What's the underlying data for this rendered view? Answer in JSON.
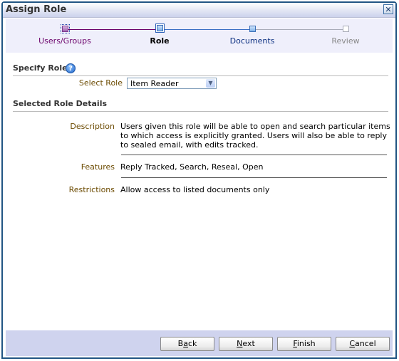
{
  "window": {
    "title": "Assign Role",
    "close_icon": "close-x-icon"
  },
  "train": {
    "steps": [
      {
        "label": "Users/Groups",
        "state": "visited",
        "color": "#6a006a"
      },
      {
        "label": "Role",
        "state": "current",
        "color": "#000000"
      },
      {
        "label": "Documents",
        "state": "next",
        "color": "#0b2f80"
      },
      {
        "label": "Review",
        "state": "disabled",
        "color": "#888888"
      }
    ]
  },
  "specify_role": {
    "heading": "Specify Role",
    "help_icon": "help-question-icon",
    "select_label": "Select Role",
    "select_value": "Item Reader"
  },
  "details": {
    "heading": "Selected Role Details",
    "rows": [
      {
        "label": "Description",
        "value": "Users given this role will be able to open and search particular items to which access is explicitly granted. Users will also be able to reply to sealed email, with edits tracked."
      },
      {
        "label": "Features",
        "value": "Reply Tracked, Search, Reseal, Open"
      },
      {
        "label": "Restrictions",
        "value": "Allow access to listed documents only"
      }
    ]
  },
  "footer": {
    "buttons": [
      {
        "pre": "B",
        "mnemonic": "a",
        "post": "ck"
      },
      {
        "pre": "",
        "mnemonic": "N",
        "post": "ext"
      },
      {
        "pre": "",
        "mnemonic": "F",
        "post": "inish"
      },
      {
        "pre": "",
        "mnemonic": "C",
        "post": "ancel"
      }
    ]
  }
}
